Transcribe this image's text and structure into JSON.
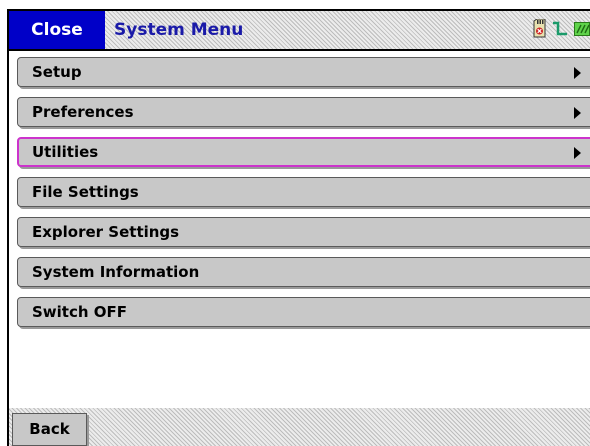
{
  "header": {
    "close_label": "Close",
    "title": "System Menu",
    "status_icons": [
      "sd-card-icon",
      "signal-icon",
      "battery-icon"
    ]
  },
  "menu": {
    "items": [
      {
        "label": "Setup",
        "has_submenu": true,
        "selected": false
      },
      {
        "label": "Preferences",
        "has_submenu": true,
        "selected": false
      },
      {
        "label": "Utilities",
        "has_submenu": true,
        "selected": true
      },
      {
        "label": "File Settings",
        "has_submenu": false,
        "selected": false
      },
      {
        "label": "Explorer Settings",
        "has_submenu": false,
        "selected": false
      },
      {
        "label": "System Information",
        "has_submenu": false,
        "selected": false
      },
      {
        "label": "Switch OFF",
        "has_submenu": false,
        "selected": false
      }
    ]
  },
  "footer": {
    "back_label": "Back"
  },
  "colors": {
    "header_accent": "#0000c8",
    "title_text": "#1a1aa8",
    "menu_button": "#c8c8c8",
    "selected_border": "#cc33cc"
  }
}
